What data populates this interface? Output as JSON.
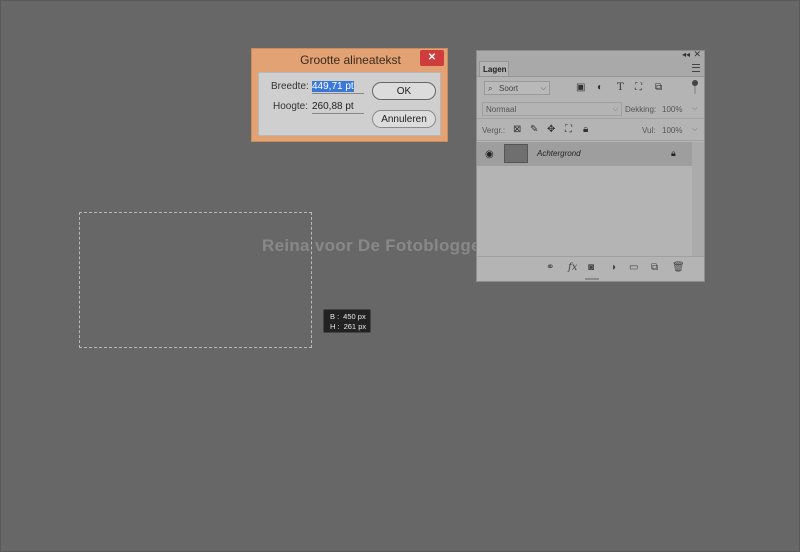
{
  "canvas": {
    "watermark": "Reina voor De Fotoblogger",
    "size_tooltip": {
      "w_label": "B :",
      "w_value": "450 px",
      "h_label": "H :",
      "h_value": "261 px"
    }
  },
  "dialog": {
    "title": "Grootte alineatekst",
    "close_glyph": "✕",
    "width_label": "Breedte:",
    "width_value": "449,71 pt",
    "height_label": "Hoogte:",
    "height_value": "260,88 pt",
    "ok_label": "OK",
    "cancel_label": "Annuleren"
  },
  "layers_panel": {
    "tab_label": "Lagen",
    "collapse_glyph": "◂◂",
    "close_glyph": "✕",
    "filter_placeholder": "Soort",
    "filter_icons": [
      "image-filter-icon",
      "adjustment-filter-icon",
      "type-filter-icon",
      "shape-filter-icon",
      "smart-object-filter-icon"
    ],
    "blend_mode": "Normaal",
    "opacity_label": "Dekking:",
    "opacity_value": "100%",
    "lock_label": "Vergr.:",
    "fill_label": "Vul:",
    "fill_value": "100%",
    "layer": {
      "name": "Achtergrond"
    },
    "bottom_icons": [
      "link-icon",
      "fx-icon",
      "mask-icon",
      "adjustment-icon",
      "folder-icon",
      "new-layer-icon",
      "trash-icon"
    ]
  }
}
